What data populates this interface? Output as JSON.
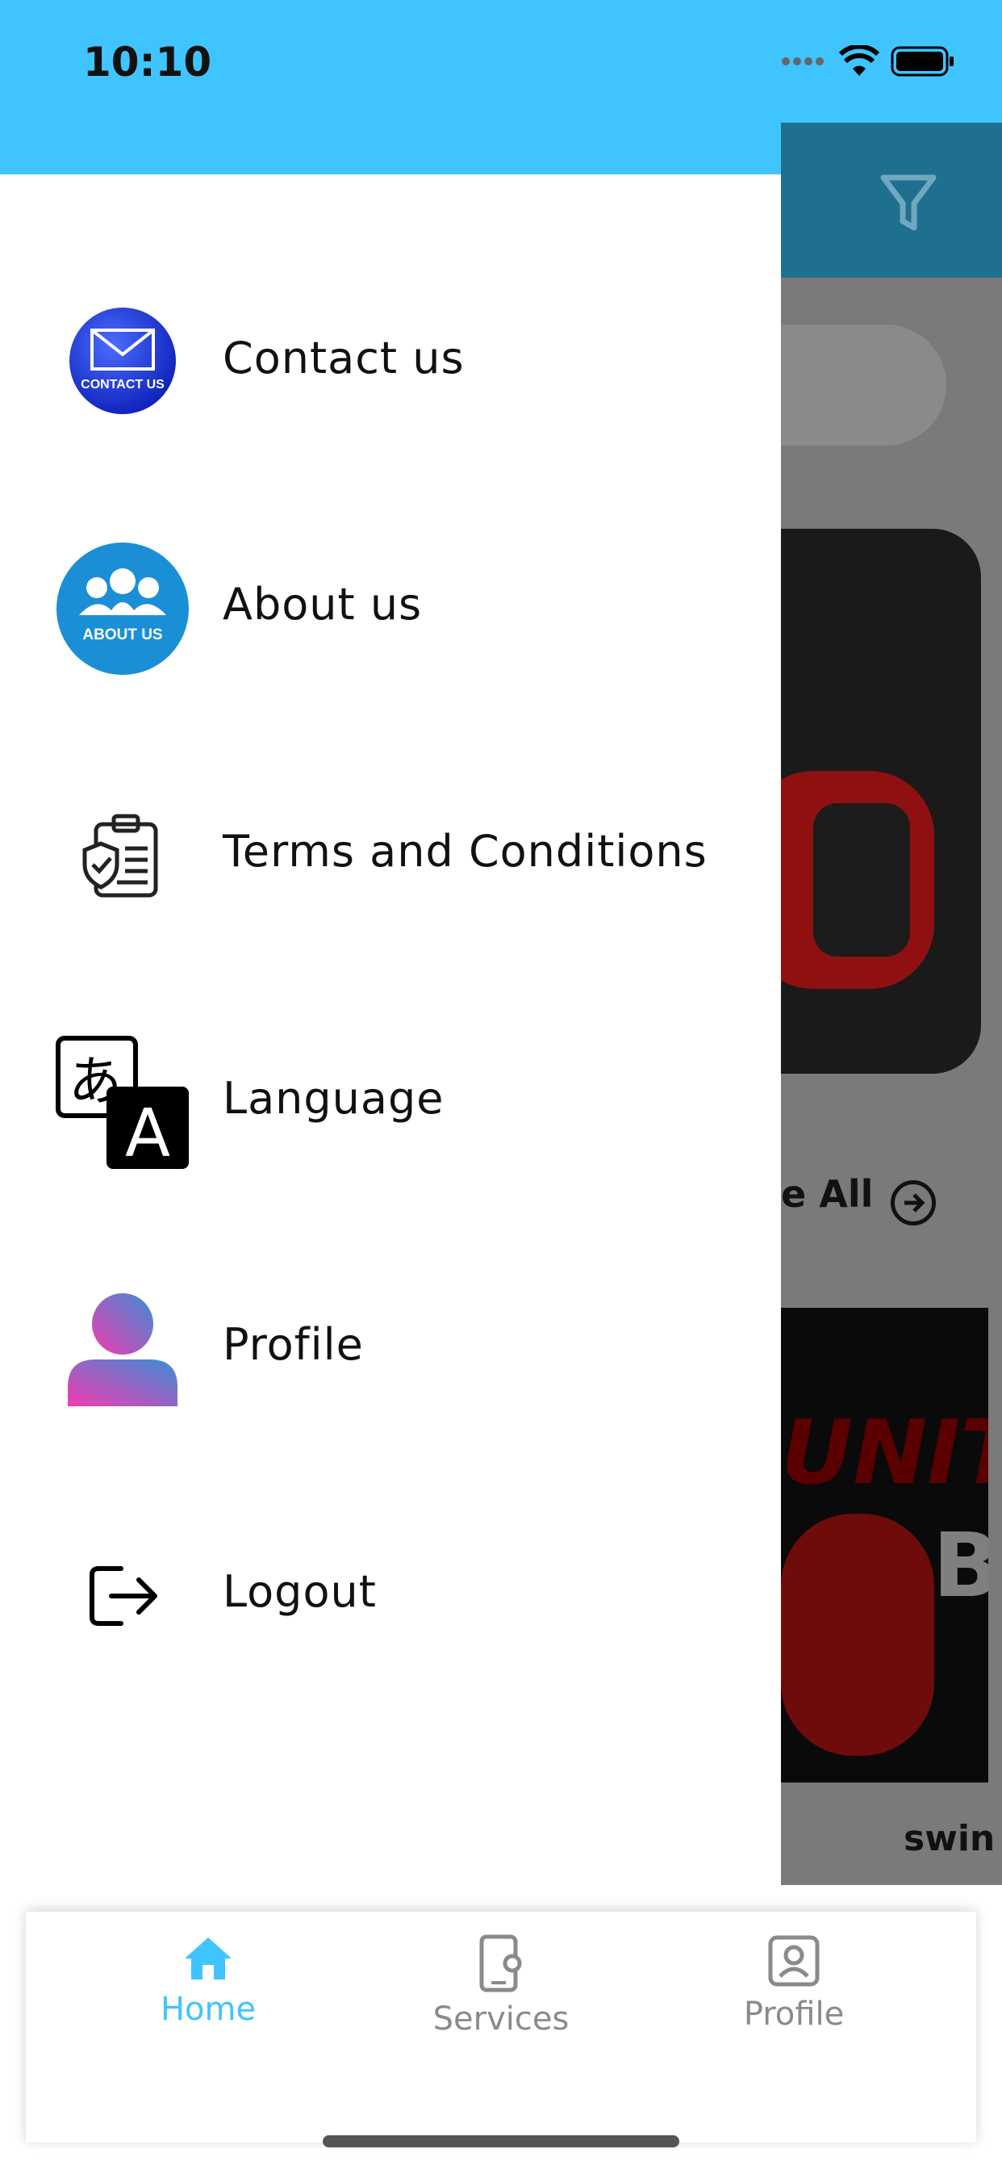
{
  "status_bar": {
    "time": "10:10"
  },
  "drawer": {
    "items": [
      {
        "label": "Contact us",
        "icon": "contact-us-icon"
      },
      {
        "label": "About us",
        "icon": "about-us-icon"
      },
      {
        "label": "Terms and Conditions",
        "icon": "clipboard-shield-icon"
      },
      {
        "label": "Language",
        "icon": "language-icon"
      },
      {
        "label": "Profile",
        "icon": "person-icon"
      },
      {
        "label": "Logout",
        "icon": "logout-icon"
      }
    ],
    "contact_badge": "CONTACT US",
    "about_badge": "ABOUT US",
    "lang_glyph_1": "あ",
    "lang_glyph_2": "A"
  },
  "background": {
    "see_all_label": "e All",
    "list_title_partial": "swin",
    "image_text_1": "UNIT",
    "image_text_2": "Bo"
  },
  "bottom_nav": {
    "items": [
      {
        "label": "Home",
        "icon": "home-icon",
        "active": true
      },
      {
        "label": "Services",
        "icon": "phone-gear-icon",
        "active": false
      },
      {
        "label": "Profile",
        "icon": "profile-card-icon",
        "active": false
      }
    ]
  },
  "colors": {
    "accent": "#40C4FF",
    "appbar_dim": "#1f6f8f",
    "inactive": "#8a8a8a"
  }
}
